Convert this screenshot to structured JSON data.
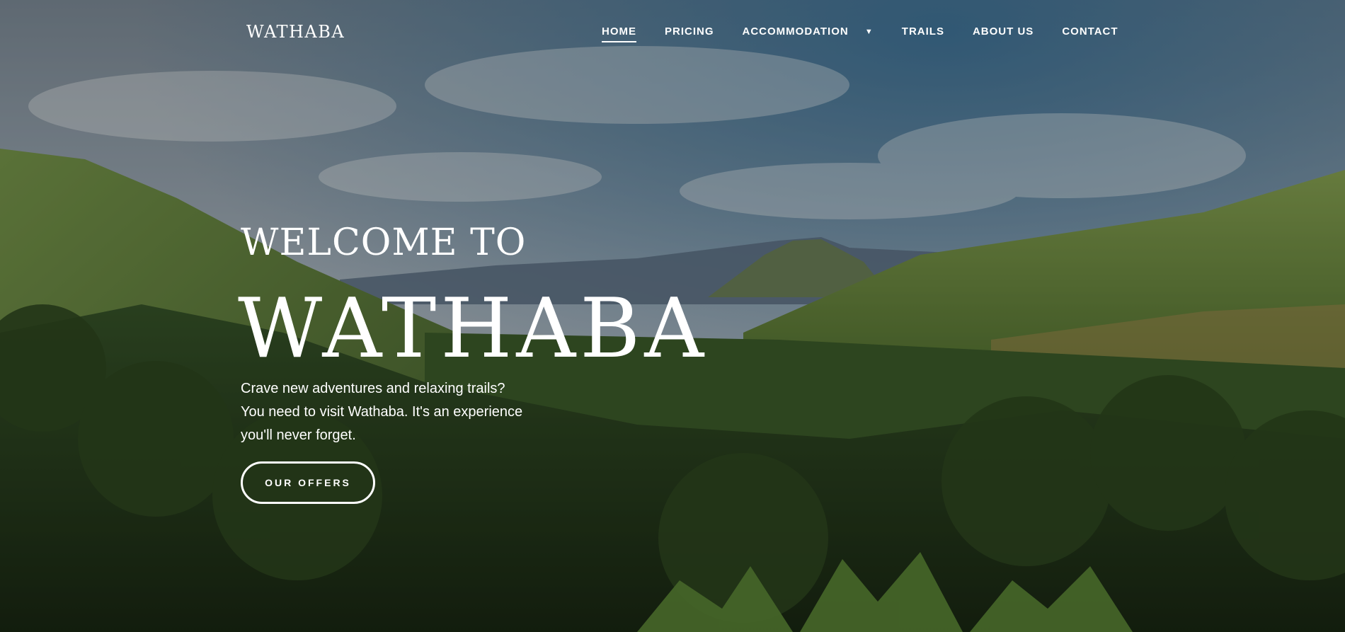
{
  "header": {
    "logo": "WATHABA",
    "nav": {
      "home": "HOME",
      "pricing": "PRICING",
      "accommodation": "ACCOMMODATION",
      "accommodation_caret": "▼",
      "trails": "TRAILS",
      "about": "ABOUT US",
      "contact": "CONTACT"
    }
  },
  "hero": {
    "welcome": "WELCOME TO",
    "title": "WATHABA",
    "tagline": [
      "Crave new adventures and relaxing trails?",
      "You need to visit Wathaba. It's an experience",
      "you'll never forget."
    ],
    "cta": "OUR OFFERS"
  },
  "colors": {
    "text": "#ffffff",
    "sky": "#9fb2c4",
    "grass": "#6f8f3c",
    "forest": "#24361c"
  }
}
